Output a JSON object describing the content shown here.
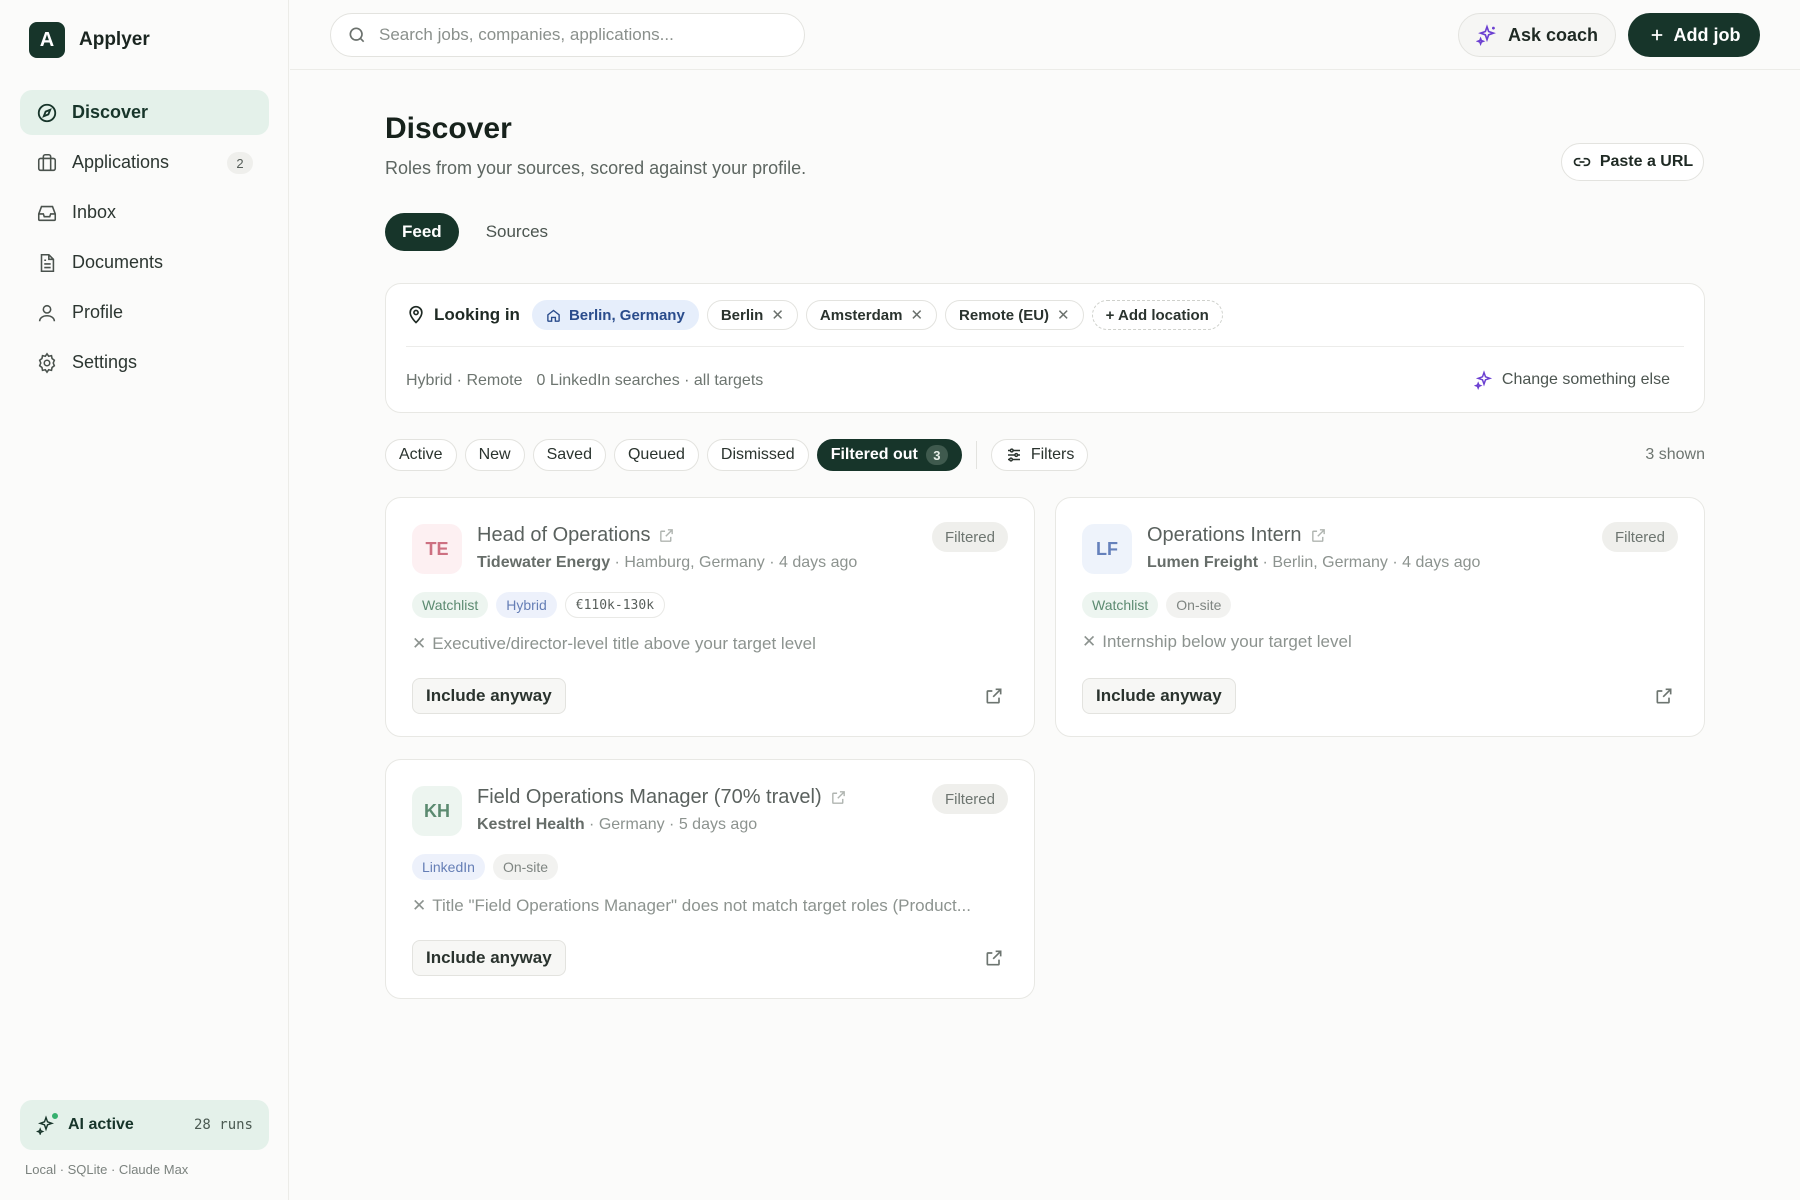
{
  "app": {
    "brand_letter": "A",
    "brand_name": "Applyer"
  },
  "sidebar": {
    "items": [
      {
        "label": "Discover",
        "icon": "compass-icon",
        "active": true
      },
      {
        "label": "Applications",
        "icon": "briefcase-icon",
        "badge": "2"
      },
      {
        "label": "Inbox",
        "icon": "inbox-icon"
      },
      {
        "label": "Documents",
        "icon": "document-icon"
      },
      {
        "label": "Profile",
        "icon": "user-icon"
      },
      {
        "label": "Settings",
        "icon": "gear-icon"
      }
    ],
    "ai_status": {
      "label": "AI active",
      "runs": "28 runs"
    },
    "footer": "Local · SQLite · Claude Max"
  },
  "topbar": {
    "search_placeholder": "Search jobs, companies, applications...",
    "ask_coach": "Ask coach",
    "add_job": "Add job"
  },
  "main": {
    "title": "Discover",
    "subtitle": "Roles from your sources, scored against your profile.",
    "paste_url": "Paste a URL",
    "tabs": [
      {
        "label": "Feed",
        "active": true
      },
      {
        "label": "Sources"
      }
    ],
    "locations": {
      "label": "Looking in",
      "home": "Berlin, Germany",
      "chips": [
        "Berlin",
        "Amsterdam",
        "Remote (EU)"
      ],
      "add": "+ Add location",
      "meta_mode": "Hybrid · Remote",
      "meta_searches": "0 LinkedIn searches · all targets",
      "change": "Change something else"
    },
    "filters": {
      "chips": [
        "Active",
        "New",
        "Saved",
        "Queued",
        "Dismissed"
      ],
      "active_chip": "Filtered out",
      "active_count": "3",
      "filters_button": "Filters",
      "shown": "3 shown"
    },
    "cards": [
      {
        "initials": "TE",
        "title": "Head of Operations",
        "company": "Tidewater Energy",
        "meta": " · Hamburg, Germany · 4 days ago",
        "status": "Filtered",
        "tags": [
          "Watchlist",
          "Hybrid",
          "€110k-130k"
        ],
        "reason": "Executive/director-level title above your target level",
        "include": "Include anyway"
      },
      {
        "initials": "LF",
        "title": "Operations Intern",
        "company": "Lumen Freight",
        "meta": " · Berlin, Germany · 4 days ago",
        "status": "Filtered",
        "tags": [
          "Watchlist",
          "On-site"
        ],
        "reason": "Internship below your target level",
        "include": "Include anyway"
      },
      {
        "initials": "KH",
        "title": "Field Operations Manager (70% travel)",
        "company": "Kestrel Health",
        "meta": " · Germany · 5 days ago",
        "status": "Filtered",
        "tags": [
          "LinkedIn",
          "On-site"
        ],
        "reason": "Title \"Field Operations Manager\" does not match target roles (Product...",
        "include": "Include anyway"
      }
    ]
  },
  "colors": {
    "brand_dark": "#17352a",
    "accent_mint": "#e4f1ea",
    "ai_green": "#35b06e",
    "coach_purple": "#6b3fd1",
    "te_avatar_bg": "#fdecef",
    "te_avatar_fg": "#c0485e",
    "lf_avatar_bg": "#eaf0fb",
    "lf_avatar_fg": "#3b5ea8",
    "kh_avatar_bg": "#e8f3ec",
    "kh_avatar_fg": "#2e6a49"
  }
}
